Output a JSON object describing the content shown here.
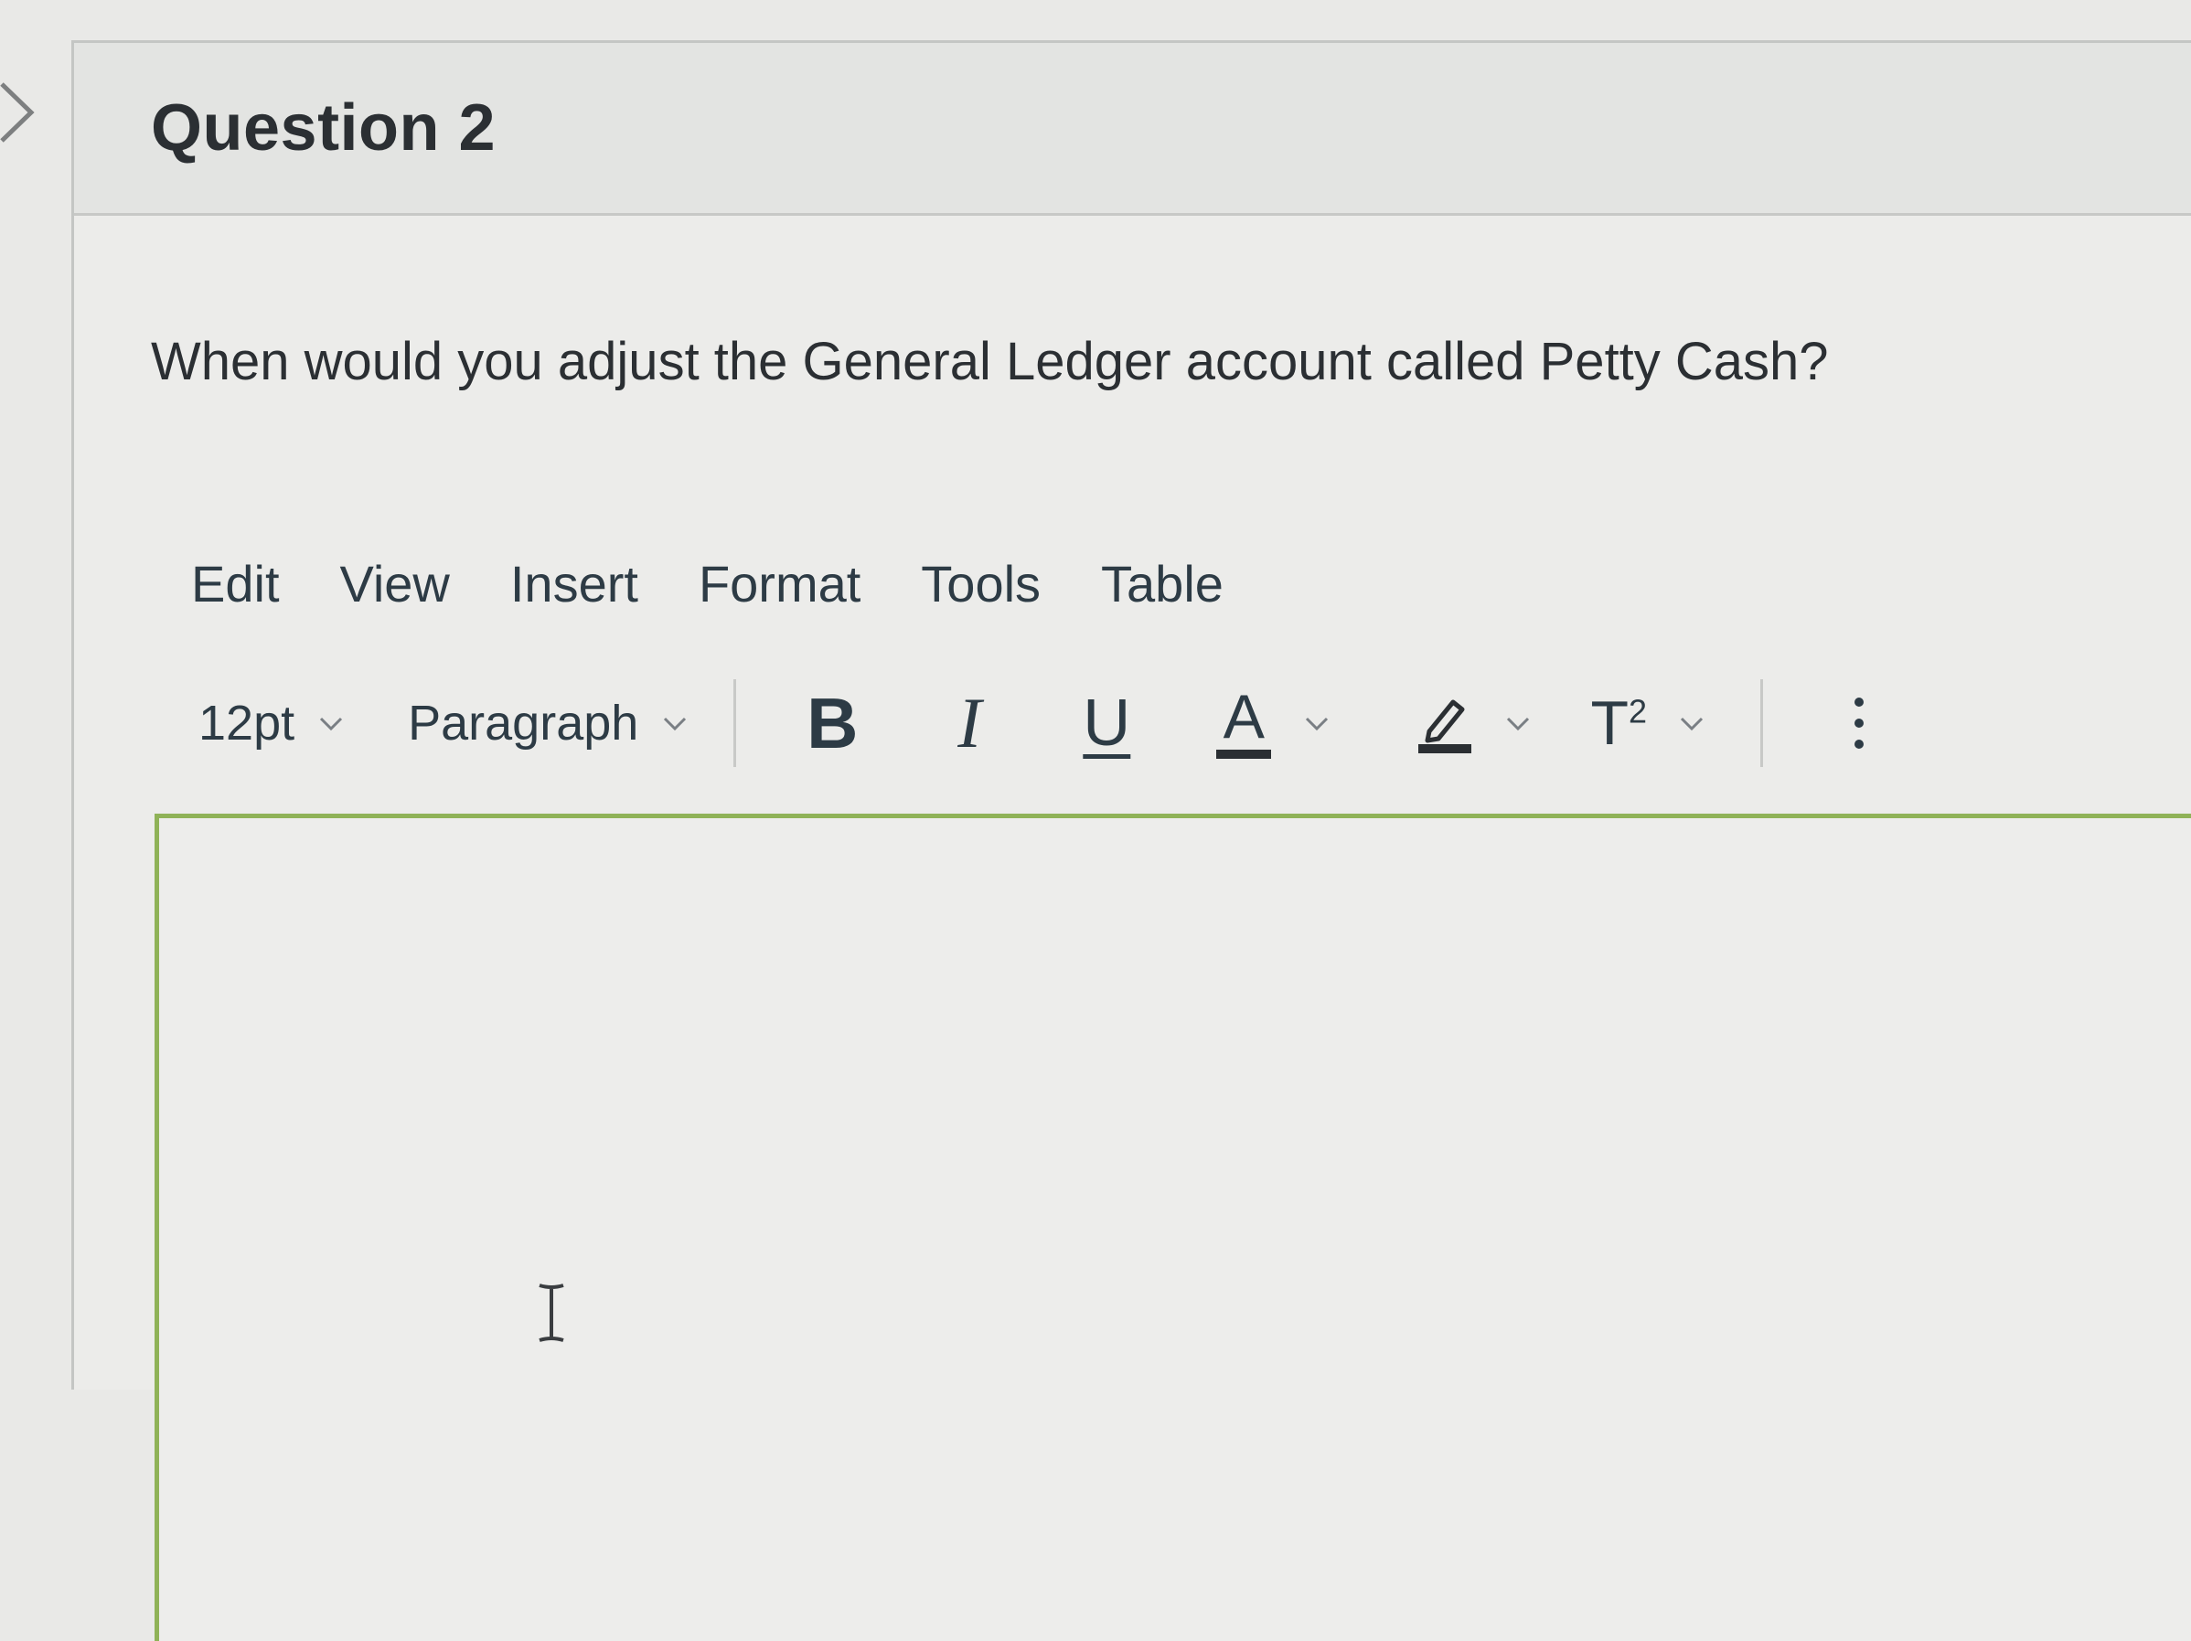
{
  "question": {
    "title": "Question 2",
    "text": "When would you adjust the General Ledger account called Petty Cash?"
  },
  "editor": {
    "menu": [
      "Edit",
      "View",
      "Insert",
      "Format",
      "Tools",
      "Table"
    ],
    "toolbar": {
      "font_size": "12pt",
      "block_format": "Paragraph",
      "bold_label": "B",
      "italic_label": "I",
      "underline_label": "U",
      "text_color_label": "A",
      "superscript_label": "T",
      "superscript_exp": "2",
      "icons": [
        "bold-icon",
        "italic-icon",
        "underline-icon",
        "text-color-icon",
        "highlight-icon",
        "superscript-icon",
        "more-icon"
      ]
    },
    "accent_color": "#8fb257"
  }
}
